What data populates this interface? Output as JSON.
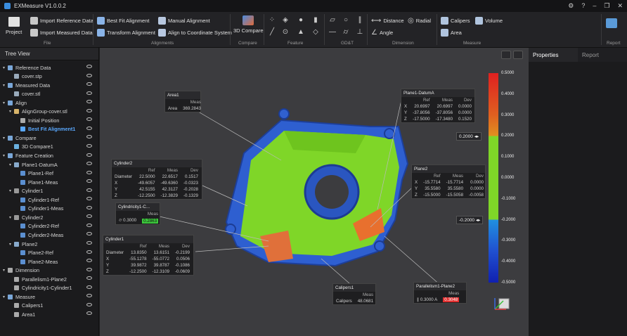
{
  "app": {
    "title": "EXMeasure V1.0.0.2"
  },
  "ribbon": {
    "project_label": "Project",
    "file_group": "File",
    "import_reference": "Import Reference Data",
    "import_measured": "Import Measured Data",
    "best_fit": "Best Fit Alignment",
    "transform": "Transform Alignment",
    "manual": "Manual Alignment",
    "align_coord": "Align to Coordinate System",
    "alignments_group": "Alignments",
    "compare3d": "3D Compare",
    "compare_group": "Compare",
    "feature_group": "Feature",
    "gdt_group": "GD&T",
    "distance": "Distance",
    "radial": "Radial",
    "angle": "Angle",
    "dimension_group": "Dimension",
    "calipers": "Calipers",
    "volume": "Volume",
    "area": "Area",
    "measure_group": "Measure",
    "report": "Report",
    "report_group": "Report"
  },
  "sidebar": {
    "header": "Tree View",
    "items": [
      {
        "label": "Reference Data",
        "level": 0,
        "color": "#7aa7d8"
      },
      {
        "label": "cover.stp",
        "level": 1,
        "color": "#9ab"
      },
      {
        "label": "Measured Data",
        "level": 0,
        "color": "#7aa7d8"
      },
      {
        "label": "cover.stl",
        "level": 1,
        "color": "#9ab"
      },
      {
        "label": "Align",
        "level": 0,
        "color": "#7aa7d8"
      },
      {
        "label": "AlignGroup-cover.stl",
        "level": 1,
        "color": "#d8b46a"
      },
      {
        "label": "Initial Position",
        "level": 2,
        "color": "#aaa"
      },
      {
        "label": "Best Fit Alignment1",
        "level": 2,
        "color": "#5aa9ff",
        "active": true
      },
      {
        "label": "Compare",
        "level": 0,
        "color": "#7aa7d8"
      },
      {
        "label": "3D Compare1",
        "level": 1,
        "color": "#6ab0e0"
      },
      {
        "label": "Feature Creation",
        "level": 0,
        "color": "#7aa7d8"
      },
      {
        "label": "Plane1-DatumA",
        "level": 1,
        "color": "#8ac"
      },
      {
        "label": "Plane1-Ref",
        "level": 2,
        "color": "#5b8fd0"
      },
      {
        "label": "Plane1-Meas",
        "level": 2,
        "color": "#5b8fd0"
      },
      {
        "label": "Cylinder1",
        "level": 1,
        "color": "#999"
      },
      {
        "label": "Cylinder1-Ref",
        "level": 2,
        "color": "#5b8fd0"
      },
      {
        "label": "Cylinder1-Meas",
        "level": 2,
        "color": "#5b8fd0"
      },
      {
        "label": "Cylinder2",
        "level": 1,
        "color": "#999"
      },
      {
        "label": "Cylinder2-Ref",
        "level": 2,
        "color": "#5b8fd0"
      },
      {
        "label": "Cylinder2-Meas",
        "level": 2,
        "color": "#5b8fd0"
      },
      {
        "label": "Plane2",
        "level": 1,
        "color": "#8ac"
      },
      {
        "label": "Plane2-Ref",
        "level": 2,
        "color": "#5b8fd0"
      },
      {
        "label": "Plane2-Meas",
        "level": 2,
        "color": "#5b8fd0"
      },
      {
        "label": "Dimension",
        "level": 0,
        "color": "#aaa"
      },
      {
        "label": "Parallelism1-Plane2",
        "level": 1,
        "color": "#aaa"
      },
      {
        "label": "Cylindricity1-Cylinder1",
        "level": 1,
        "color": "#aaa"
      },
      {
        "label": "Measure",
        "level": 0,
        "color": "#7aa7d8"
      },
      {
        "label": "Calipers1",
        "level": 1,
        "color": "#aaa"
      },
      {
        "label": "Area1",
        "level": 1,
        "color": "#aaa"
      }
    ]
  },
  "right_panel": {
    "tab_properties": "Properties",
    "tab_report": "Report"
  },
  "colorscale": {
    "labels": [
      "0.5000",
      "0.4000",
      "0.3000",
      "0.2000",
      "0.1000",
      "0.0000",
      "-0.1000",
      "-0.2000",
      "-0.3000",
      "-0.4000",
      "-0.5000"
    ],
    "upper_marker": "0.2000",
    "lower_marker": "-0.2000"
  },
  "boxes": {
    "area1": {
      "title": "Area1",
      "meas_h": "Meas",
      "label": "Area",
      "value": "369.2843"
    },
    "plane1": {
      "title": "Plane1-DatumA",
      "h": [
        "Ref",
        "Meas",
        "Dev"
      ],
      "rows": [
        [
          "X",
          "20.6997",
          "20.6997",
          "0.0000"
        ],
        [
          "Y",
          "-37.8056",
          "-37.8056",
          "0.0000"
        ],
        [
          "Z",
          "-17.5000",
          "-17.3480",
          "0.1520"
        ]
      ]
    },
    "cylinder2": {
      "title": "Cylinder2",
      "h": [
        "Ref",
        "Meas",
        "Dev"
      ],
      "rows": [
        [
          "Diameter",
          "22.5000",
          "22.6517",
          "0.1517"
        ],
        [
          "X",
          "-49.6057",
          "-49.6360",
          "-0.0323"
        ],
        [
          "Y",
          "42.5155",
          "42.3127",
          "-0.2028"
        ],
        [
          "Z",
          "-12.2500",
          "-12.3829",
          "-0.1329"
        ]
      ]
    },
    "plane2": {
      "title": "Plane2",
      "h": [
        "Ref",
        "Meas",
        "Dev"
      ],
      "rows": [
        [
          "X",
          "-15.7714",
          "-15.7714",
          "0.0000"
        ],
        [
          "Y",
          "35.5580",
          "35.5580",
          "0.0000"
        ],
        [
          "Z",
          "-15.5000",
          "-15.5058",
          "-0.0058"
        ]
      ]
    },
    "cylindricity": {
      "title": "Cylindricity1-C...",
      "meas_h": "Meas",
      "tol": "0.3000",
      "value": "0.2863"
    },
    "cylinder1": {
      "title": "Cylinder1",
      "h": [
        "Ref",
        "Meas",
        "Dev"
      ],
      "rows": [
        [
          "Diameter",
          "13.8350",
          "13.6151",
          "-0.2199"
        ],
        [
          "X",
          "-55.1278",
          "-55.0772",
          "0.0506"
        ],
        [
          "Y",
          "39.9872",
          "39.8787",
          "-0.1086"
        ],
        [
          "Z",
          "-12.2500",
          "-12.3109",
          "-0.0609"
        ]
      ]
    },
    "calipers1": {
      "title": "Calipers1",
      "meas_h": "Meas",
      "label": "Calipers",
      "value": "48.0681"
    },
    "parallelism": {
      "title": "Parallelism1-Plane2",
      "meas_h": "Meas",
      "tol": "0.3000",
      "a": "A",
      "value": "0.3048"
    }
  }
}
